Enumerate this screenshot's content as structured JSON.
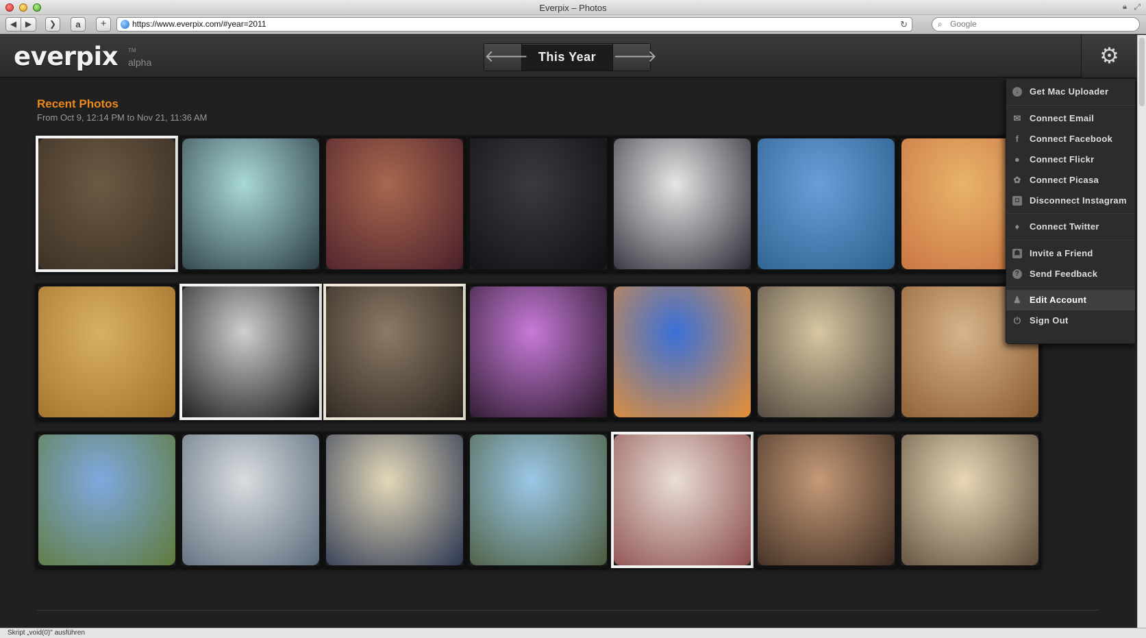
{
  "window": {
    "title": "Everpix – Photos"
  },
  "browser": {
    "url": "https://www.everpix.com/#year=2011",
    "search_placeholder": "Google",
    "back_icon": "◀",
    "forward_icon": "▶",
    "add_icon": "+",
    "amazon_icon": "a"
  },
  "header": {
    "logo": "everpix",
    "tm": "TM",
    "alpha": "alpha",
    "year_label": "This Year",
    "prev_icon": "arrow-left-icon",
    "next_icon": "arrow-right-icon"
  },
  "section": {
    "title": "Recent Photos",
    "subtitle": "From Oct 9, 12:14 PM to Nov 21, 11:36 AM"
  },
  "photos": [
    {
      "c1": "#6b5a44",
      "c2": "#3a2e22",
      "frame": "white"
    },
    {
      "c1": "#a9d8d8",
      "c2": "#2b3b45",
      "frame": "dark"
    },
    {
      "c1": "#a8674f",
      "c2": "#4a1f2a",
      "frame": "dark"
    },
    {
      "c1": "#3a3a3f",
      "c2": "#0f1014",
      "frame": "dark"
    },
    {
      "c1": "#e6e6e6",
      "c2": "#2a2a35",
      "frame": "dark"
    },
    {
      "c1": "#6a9ed9",
      "c2": "#2b5f8c",
      "frame": "dark"
    },
    {
      "c1": "#e8b36a",
      "c2": "#c97040",
      "frame": "dark"
    },
    {
      "c1": "#d9b063",
      "c2": "#a0722a",
      "frame": "dark"
    },
    {
      "c1": "#cfcfcf",
      "c2": "#111111",
      "frame": "white"
    },
    {
      "c1": "#8c7a66",
      "c2": "#2a241d",
      "frame": "cream"
    },
    {
      "c1": "#c77ad9",
      "c2": "#241524",
      "frame": "dark"
    },
    {
      "c1": "#3a70d9",
      "c2": "#e89033",
      "frame": "dark"
    },
    {
      "c1": "#d7c7a2",
      "c2": "#4a4038",
      "frame": "dark"
    },
    {
      "c1": "#d8b48a",
      "c2": "#8a5a30",
      "frame": "dark"
    },
    {
      "c1": "#7fa9e0",
      "c2": "#5f7a3a",
      "frame": "dark"
    },
    {
      "c1": "#d9dde0",
      "c2": "#5a6a7a",
      "frame": "dark"
    },
    {
      "c1": "#e3d8b8",
      "c2": "#2a3550",
      "frame": "dark"
    },
    {
      "c1": "#9bc7e8",
      "c2": "#4a5a3a",
      "frame": "dark"
    },
    {
      "c1": "#e9dfd5",
      "c2": "#8a4a4a",
      "frame": "white"
    },
    {
      "c1": "#c59a78",
      "c2": "#3a2a20",
      "frame": "dark"
    },
    {
      "c1": "#e8d8b8",
      "c2": "#5a4a38",
      "frame": "dark"
    }
  ],
  "menu": {
    "items": [
      {
        "label": "Get Mac Uploader",
        "icon": "download-icon"
      },
      {
        "label": "Connect Email",
        "icon": "envelope-icon"
      },
      {
        "label": "Connect Facebook",
        "icon": "facebook-icon"
      },
      {
        "label": "Connect Flickr",
        "icon": "flickr-icon"
      },
      {
        "label": "Connect Picasa",
        "icon": "picasa-icon"
      },
      {
        "label": "Disconnect Instagram",
        "icon": "instagram-icon"
      },
      {
        "label": "Connect Twitter",
        "icon": "twitter-icon"
      },
      {
        "label": "Invite a Friend",
        "icon": "invite-icon"
      },
      {
        "label": "Send Feedback",
        "icon": "question-icon"
      },
      {
        "label": "Edit Account",
        "icon": "person-icon"
      },
      {
        "label": "Sign Out",
        "icon": "power-icon"
      }
    ]
  },
  "status": {
    "text": "Skript „void(0)\" ausführen"
  }
}
